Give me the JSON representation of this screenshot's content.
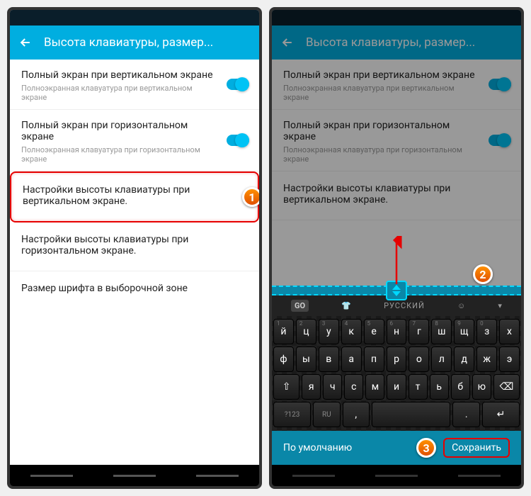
{
  "title": "Высота клавиатуры, размер...",
  "settings": {
    "s1": {
      "title": "Полный экран при вертикальном экране",
      "sub": "Полноэкранная клавуатура при вертикальном экране"
    },
    "s2": {
      "title": "Полный экран при горизонтальном экране",
      "sub": "Полноэкранная клавуатура при горизонтальном экране"
    },
    "s3": {
      "title": "Настройки высоты клавиатуры при вертикальном экране."
    },
    "s4": {
      "title": "Настройки высоты клавиатуры при горизонтальном экране."
    },
    "s5": {
      "title": "Размер шрифта в выборочной зоне"
    }
  },
  "markers": {
    "m1": "1",
    "m2": "2",
    "m3": "3"
  },
  "keyboard": {
    "lang": "РУССКИЙ",
    "go": "GO",
    "row1": [
      "й",
      "ц",
      "у",
      "к",
      "е",
      "н",
      "г",
      "ш",
      "щ",
      "з",
      "х"
    ],
    "row1sup": [
      "1",
      "2",
      "3",
      "4",
      "5",
      "6",
      "7",
      "8",
      "9",
      "0",
      ""
    ],
    "row2": [
      "ф",
      "ы",
      "в",
      "а",
      "п",
      "р",
      "о",
      "л",
      "д",
      "ж",
      "э"
    ],
    "row3": [
      "я",
      "ч",
      "с",
      "м",
      "и",
      "т",
      "ь",
      "б",
      "ю"
    ],
    "default": "По умолчанию",
    "save": "Сохранить"
  }
}
